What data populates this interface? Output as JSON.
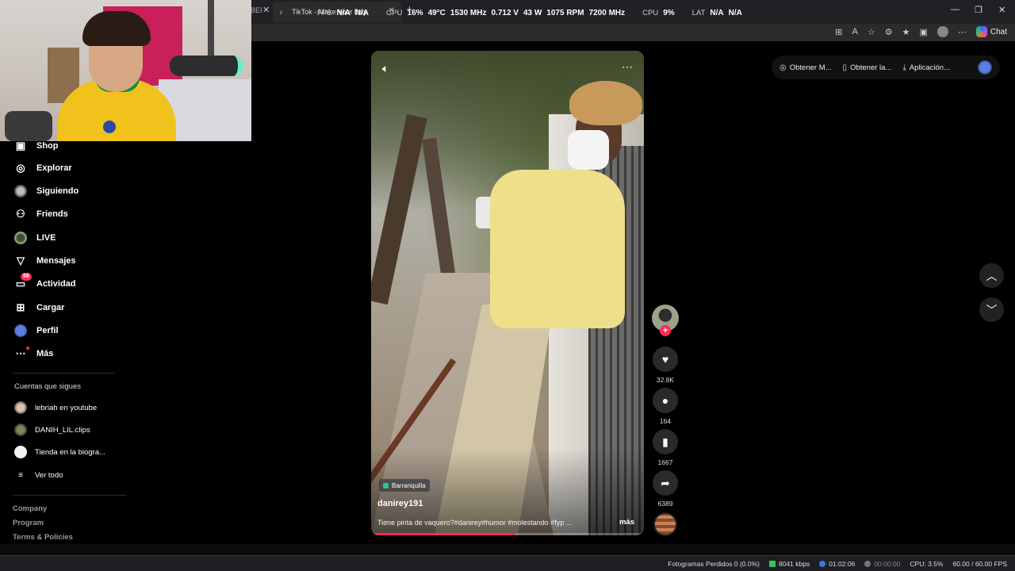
{
  "browser": {
    "prev_tab_fragment": "BEI",
    "active_tab_title": "TikTok - Make Your Day",
    "chat_label": "Chat"
  },
  "overlay": {
    "fps_label": "FPS",
    "fps_value1": "N/A",
    "fps_value2": "N/A",
    "gpu_label": "GPU",
    "gpu_usage": "16%",
    "gpu_temp": "49°C",
    "gpu_clock": "1530 MHz",
    "gpu_voltage": "0.712 V",
    "gpu_power": "43 W",
    "gpu_fan": "1075 RPM",
    "gpu_mem_clock": "7200 MHz",
    "cpu_label": "CPU",
    "cpu_usage": "9%",
    "lat_label": "LAT",
    "lat_value1": "N/A",
    "lat_value2": "N/A"
  },
  "sidebar": {
    "items": [
      {
        "label": "Shop",
        "icon": "shop-icon"
      },
      {
        "label": "Explorar",
        "icon": "compass-icon"
      },
      {
        "label": "Siguiendo",
        "icon": "following-avatar"
      },
      {
        "label": "Friends",
        "icon": "friends-icon"
      },
      {
        "label": "LIVE",
        "icon": "live-avatar"
      },
      {
        "label": "Mensajes",
        "icon": "paper-plane-icon"
      },
      {
        "label": "Actividad",
        "icon": "activity-icon",
        "badge": "58"
      },
      {
        "label": "Cargar",
        "icon": "upload-icon"
      },
      {
        "label": "Perfil",
        "icon": "profile-avatar"
      },
      {
        "label": "Más",
        "icon": "more-dots-icon"
      }
    ],
    "following_title": "Cuentas que sigues",
    "following": [
      {
        "name": "lebriah en youtube"
      },
      {
        "name": "DANIH_LIL.clips"
      },
      {
        "name": "Tienda en la biogra..."
      }
    ],
    "see_all": "Ver todo",
    "footer_links": [
      "Company",
      "Program",
      "Terms & Policies"
    ]
  },
  "video": {
    "location": "Barranquilla",
    "username": "danirey191",
    "caption": "Tiene pinta de vaquero?#danirey#humor #molestando #fyp ...",
    "more_label": "más",
    "progress": 0.53
  },
  "actions": {
    "likes": "32.8K",
    "comments": "164",
    "saves": "1667",
    "shares": "6389"
  },
  "top_pill": {
    "item1": "Obtener M...",
    "item2": "Obtener la...",
    "item3": "Aplicación..."
  },
  "statusbar": {
    "dropped_frames": "Fotogramas Perdidos 0 (0.0%)",
    "bitrate": "8041 kbps",
    "stream_time": "01:02:06",
    "rec_time": "00:00:00",
    "cpu": "CPU: 3.5%",
    "fps": "60.00 / 60.00 FPS"
  },
  "colors": {
    "accent": "#fe2c55",
    "location_chip": "#28c98a"
  }
}
